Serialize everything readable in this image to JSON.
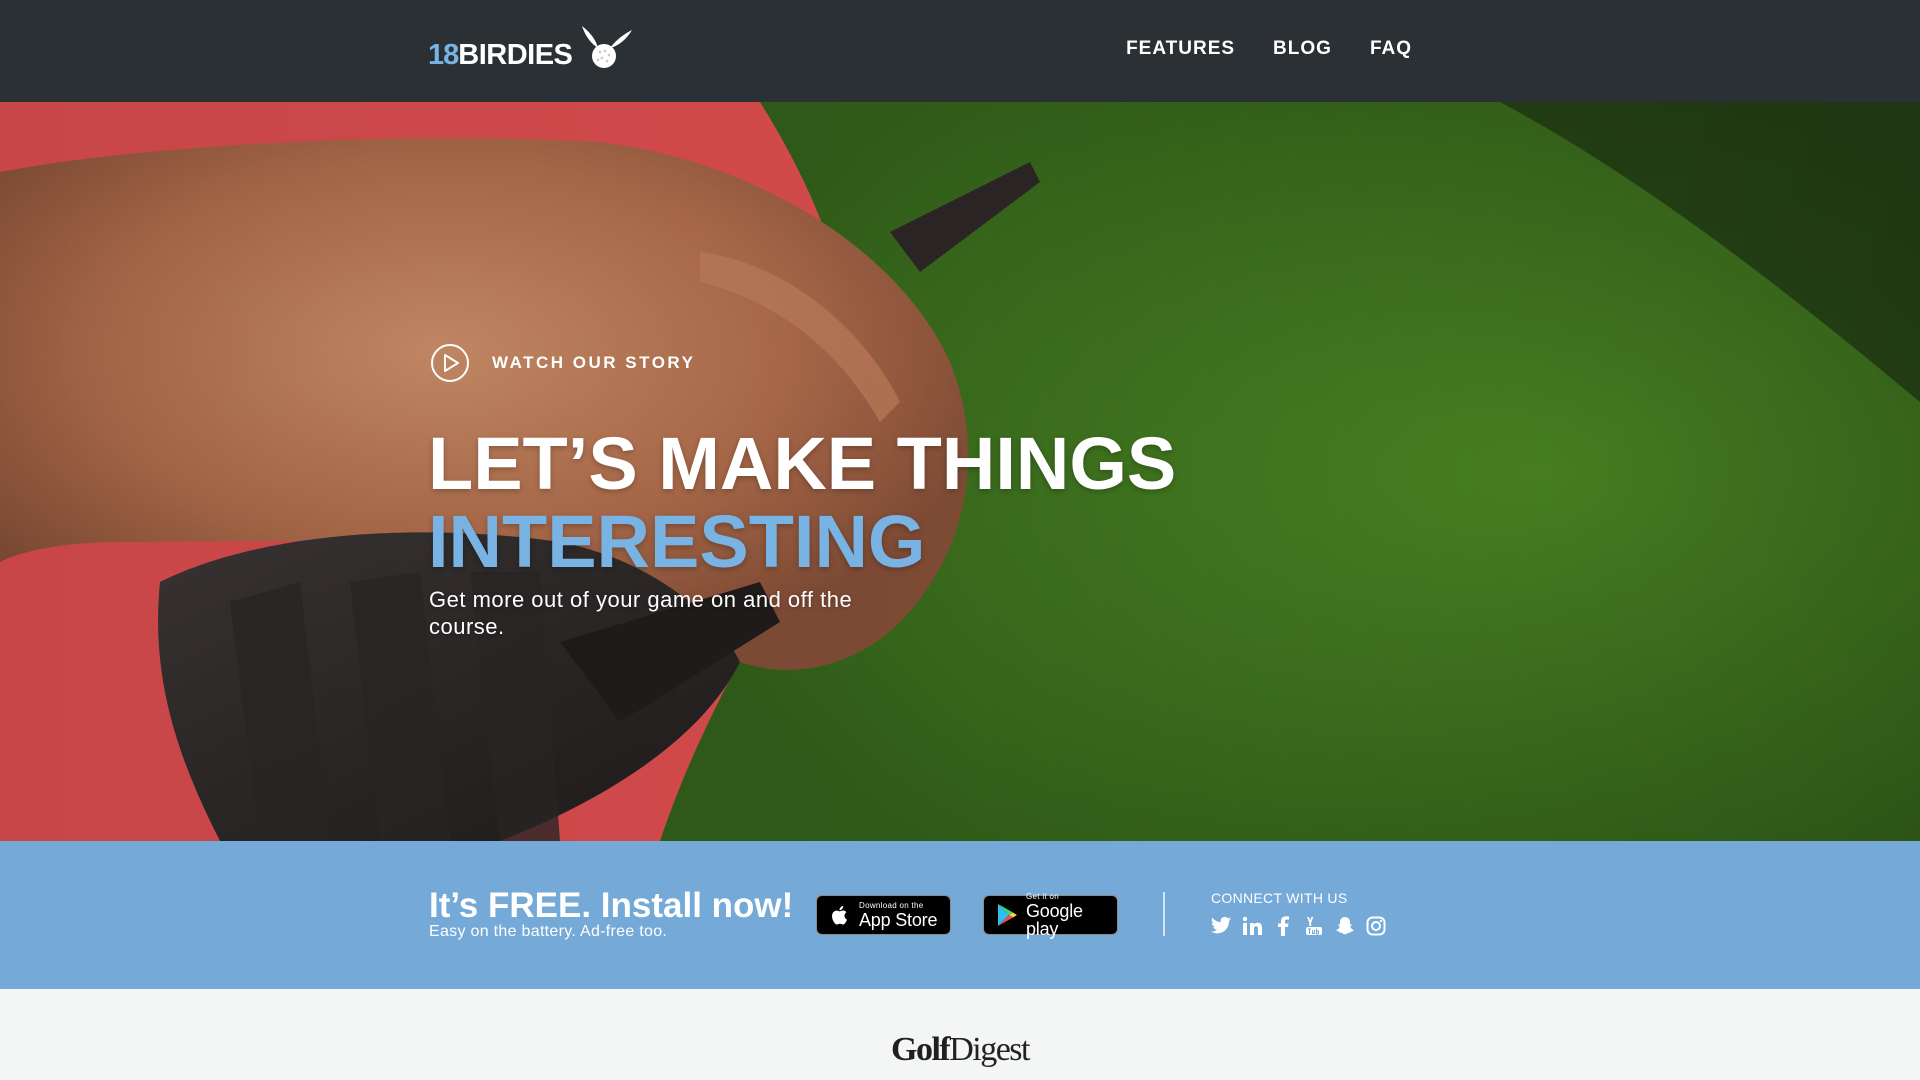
{
  "brand": {
    "logo_number": "18",
    "logo_word": "BIRDIES",
    "logo_mark": "winged-golf-ball-icon"
  },
  "nav": {
    "items": [
      {
        "label": "FEATURES"
      },
      {
        "label": "BLOG"
      },
      {
        "label": "FAQ"
      }
    ]
  },
  "hero": {
    "watch_label": "WATCH OUR STORY",
    "watch_icon": "play-circle-icon",
    "headline_line1": "LET’S MAKE THINGS",
    "headline_line2": "INTERESTING",
    "subhead": "Get more out of your game on and off the course."
  },
  "install": {
    "title": "It’s FREE. Install now!",
    "subtitle": "Easy on the battery. Ad-free too.",
    "app_store": {
      "small": "Download on the",
      "big": "App Store",
      "icon": "apple-icon"
    },
    "google_play": {
      "small": "Get it on",
      "big": "Google play",
      "icon": "google-play-icon"
    },
    "connect_label": "CONNECT WITH US",
    "social": [
      "twitter-icon",
      "linkedin-icon",
      "facebook-icon",
      "youtube-icon",
      "snapchat-icon",
      "instagram-icon"
    ]
  },
  "press": {
    "logo_part1": "Golf",
    "logo_part2": "Digest"
  },
  "colors": {
    "header_bg": "#2b3035",
    "accent_blue": "#78b3e3",
    "band_bg": "#74a9d8",
    "press_bg": "#f4f5f5"
  }
}
